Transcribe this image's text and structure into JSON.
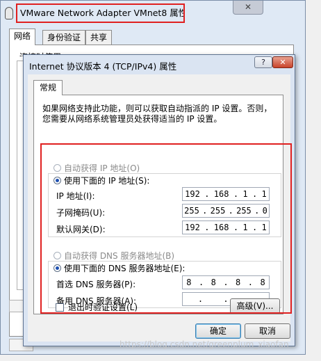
{
  "back_window": {
    "title": "VMware Network Adapter VMnet8 属性",
    "close_glyph": "✕",
    "tabs": [
      "网络",
      "身份验证",
      "共享"
    ],
    "cut_label": "连接时使用:"
  },
  "dialog": {
    "title": "Internet 协议版本 4 (TCP/IPv4) 属性",
    "help_glyph": "?",
    "close_glyph": "✕",
    "tab": "常规",
    "description": "如果网络支持此功能，则可以获取自动指派的 IP 设置。否则，您需要从网络系统管理员处获得适当的 IP 设置。",
    "ip_section": {
      "auto_label": "自动获得 IP 地址(O)",
      "manual_label": "使用下面的 IP 地址(S):",
      "selected": "manual",
      "fields": [
        {
          "label": "IP 地址(I):",
          "octets": [
            "192",
            "168",
            "1",
            "1"
          ]
        },
        {
          "label": "子网掩码(U):",
          "octets": [
            "255",
            "255",
            "255",
            "0"
          ]
        },
        {
          "label": "默认网关(D):",
          "octets": [
            "192",
            "168",
            "1",
            "1"
          ]
        }
      ]
    },
    "dns_section": {
      "auto_label": "自动获得 DNS 服务器地址(B)",
      "manual_label": "使用下面的 DNS 服务器地址(E):",
      "selected": "manual",
      "fields": [
        {
          "label": "首选 DNS 服务器(P):",
          "octets": [
            "8",
            "8",
            "8",
            "8"
          ]
        },
        {
          "label": "备用 DNS 服务器(A):",
          "octets": [
            "",
            "",
            "",
            ""
          ]
        }
      ]
    },
    "validate_label": "退出时验证设置(L)",
    "advanced_label": "高级(V)...",
    "ok_label": "确定",
    "cancel_label": "取消"
  },
  "watermark": "https://blog.csdn.net/greenplum_xiaofan",
  "colors": {
    "highlight_red": "#e02020",
    "dialog_frame": "#dae4f2"
  }
}
